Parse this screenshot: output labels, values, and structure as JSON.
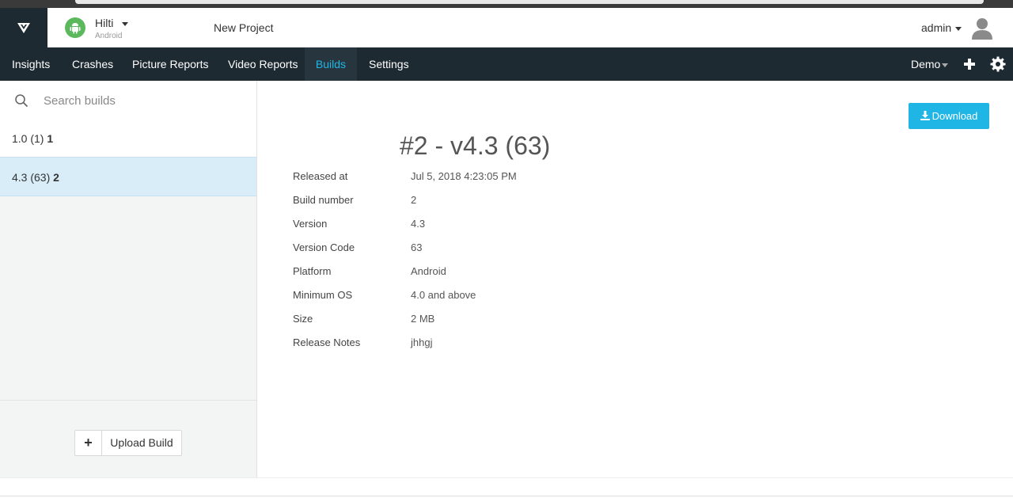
{
  "header": {
    "app": {
      "name": "Hilti",
      "platform": "Android"
    },
    "project": "New Project",
    "user": "admin"
  },
  "nav": {
    "items": [
      {
        "label": "Insights"
      },
      {
        "label": "Crashes"
      },
      {
        "label": "Picture Reports"
      },
      {
        "label": "Video Reports"
      },
      {
        "label": "Builds",
        "active": true
      },
      {
        "label": "Settings"
      }
    ],
    "workspace": "Demo"
  },
  "sidebar": {
    "search_placeholder": "Search builds",
    "builds": [
      {
        "version": "1.0 (1)",
        "number": "1",
        "selected": false
      },
      {
        "version": "4.3 (63)",
        "number": "2",
        "selected": true
      }
    ],
    "upload_label": "Upload Build"
  },
  "main": {
    "download_label": "Download",
    "title": "#2 - v4.3 (63)",
    "details": [
      {
        "label": "Released at",
        "value": "Jul 5, 2018 4:23:05 PM"
      },
      {
        "label": "Build number",
        "value": "2"
      },
      {
        "label": "Version",
        "value": "4.3"
      },
      {
        "label": "Version Code",
        "value": "63"
      },
      {
        "label": "Platform",
        "value": "Android"
      },
      {
        "label": "Minimum OS",
        "value": "4.0 and above"
      },
      {
        "label": "Size",
        "value": "2 MB"
      },
      {
        "label": "Release Notes",
        "value": "jhhgj"
      }
    ]
  },
  "colors": {
    "navbar": "#1e2a32",
    "accent": "#1fb6e6",
    "selected_row": "#d8edf8",
    "android_green": "#5cb85c"
  }
}
